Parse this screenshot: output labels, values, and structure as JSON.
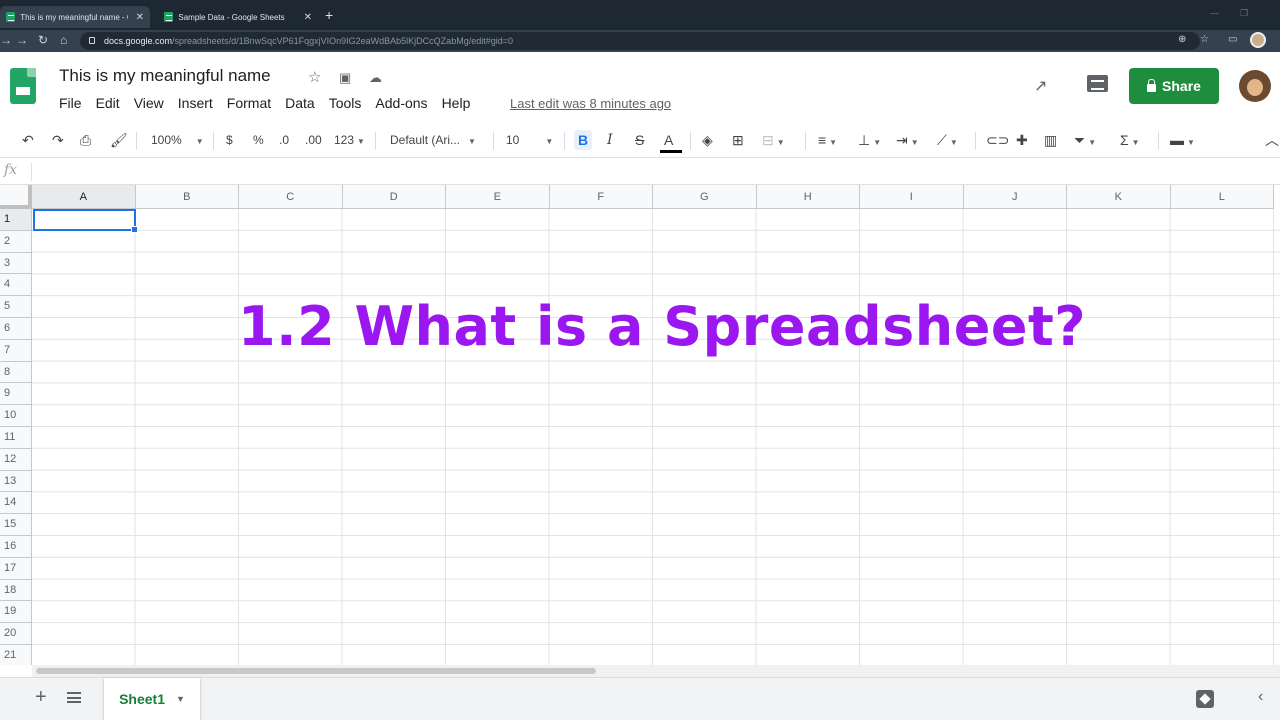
{
  "browser": {
    "tabs": [
      {
        "title": "This is my meaningful name - Go",
        "active": true
      },
      {
        "title": "Sample Data - Google Sheets",
        "active": false
      }
    ],
    "url_host": "docs.google.com",
    "url_path": "/spreadsheets/d/1BnwSqcVP61FqgxjVIOn9IG2eaWdBAb5lKjDCcQZabMg/edit#gid=0"
  },
  "doc": {
    "title": "This is my meaningful name",
    "last_edit": "Last edit was 8 minutes ago"
  },
  "menu": {
    "items": [
      "File",
      "Edit",
      "View",
      "Insert",
      "Format",
      "Data",
      "Tools",
      "Add-ons",
      "Help"
    ]
  },
  "share": {
    "label": "Share"
  },
  "toolbar": {
    "zoom": "100%",
    "currency": "$",
    "percent": "%",
    "decrease_decimals": ".0",
    "increase_decimals": ".00",
    "more_formats": "123",
    "font": "Default (Ari...",
    "font_size": "10",
    "bold": "B",
    "italic": "I",
    "strike": "S",
    "text_color": "A"
  },
  "formula_bar": {
    "fx": "fx"
  },
  "grid": {
    "columns": [
      "A",
      "B",
      "C",
      "D",
      "E",
      "F",
      "G",
      "H",
      "I",
      "J",
      "K",
      "L"
    ],
    "rows": [
      "1",
      "2",
      "3",
      "4",
      "5",
      "6",
      "7",
      "8",
      "9",
      "10",
      "11",
      "12",
      "13",
      "14",
      "15",
      "16",
      "17",
      "18",
      "19",
      "20",
      "21"
    ],
    "selected_cell": "A1"
  },
  "sheets": {
    "active": "Sheet1"
  },
  "overlay": {
    "caption": "1.2 What is a Spreadsheet?"
  },
  "colors": {
    "accent": "#1a73e8",
    "share": "#1e8e3e",
    "caption": "#9b17f0",
    "sheet_tab": "#188038"
  }
}
